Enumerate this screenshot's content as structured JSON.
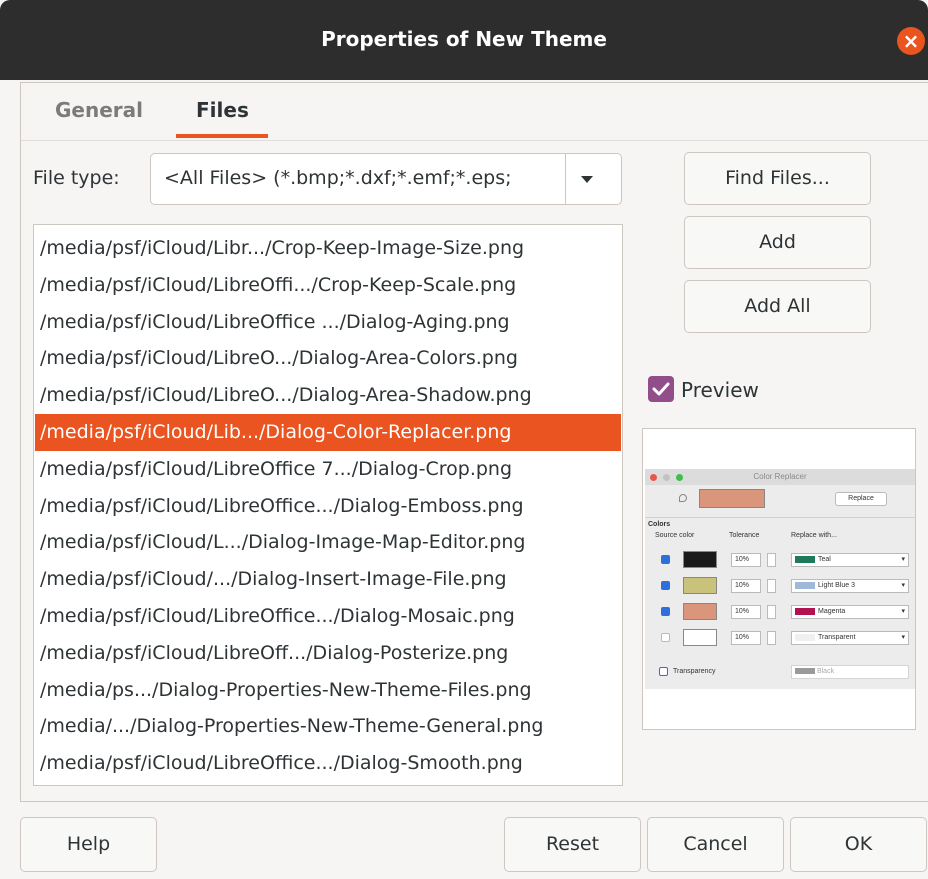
{
  "window": {
    "title": "Properties of New Theme",
    "close_glyph": "×"
  },
  "tabs": [
    {
      "label": "General",
      "active": false
    },
    {
      "label": "Files",
      "active": true
    }
  ],
  "file_type": {
    "label": "File type:",
    "value": "<All Files> (*.bmp;*.dxf;*.emf;*.eps;"
  },
  "files": [
    "/media/psf/iCloud/Libr.../Crop-Keep-Image-Size.png",
    "/media/psf/iCloud/LibreOffi.../Crop-Keep-Scale.png",
    "/media/psf/iCloud/LibreOffice .../Dialog-Aging.png",
    "/media/psf/iCloud/LibreO.../Dialog-Area-Colors.png",
    "/media/psf/iCloud/LibreO.../Dialog-Area-Shadow.png",
    "/media/psf/iCloud/Lib.../Dialog-Color-Replacer.png",
    "/media/psf/iCloud/LibreOffice 7.../Dialog-Crop.png",
    "/media/psf/iCloud/LibreOffice.../Dialog-Emboss.png",
    "/media/psf/iCloud/L.../Dialog-Image-Map-Editor.png",
    "/media/psf/iCloud/.../Dialog-Insert-Image-File.png",
    "/media/psf/iCloud/LibreOffice.../Dialog-Mosaic.png",
    "/media/psf/iCloud/LibreOff.../Dialog-Posterize.png",
    "/media/ps.../Dialog-Properties-New-Theme-Files.png",
    "/media/.../Dialog-Properties-New-Theme-General.png",
    "/media/psf/iCloud/LibreOffice.../Dialog-Smooth.png"
  ],
  "selected_file_index": 5,
  "side_buttons": {
    "find_files": "Find Files...",
    "add": "Add",
    "add_all": "Add All"
  },
  "preview": {
    "label": "Preview",
    "checked": true,
    "thumbnail": {
      "title": "Color Replacer",
      "replace_button": "Replace",
      "colors_heading": "Colors",
      "col_source": "Source color",
      "col_tolerance": "Tolerance",
      "col_replace": "Replace with...",
      "rows": [
        {
          "tolerance": "10%",
          "replace": "Teal",
          "source_color": "#1a1a1a",
          "replace_color": "#1f7a5c",
          "checked": true
        },
        {
          "tolerance": "10%",
          "replace": "Light Blue 3",
          "source_color": "#c8c27a",
          "replace_color": "#9fb9d8",
          "checked": true
        },
        {
          "tolerance": "10%",
          "replace": "Magenta",
          "source_color": "#d9967a",
          "replace_color": "#b0134f",
          "checked": true
        },
        {
          "tolerance": "10%",
          "replace": "Transparent",
          "source_color": "#ffffff",
          "replace_color": "#f0f0f0",
          "checked": false
        }
      ],
      "transparency_label": "Transparency",
      "transparency_value": "Black",
      "picked_color": "#d9967a"
    }
  },
  "footer": {
    "help": "Help",
    "reset": "Reset",
    "cancel": "Cancel",
    "ok": "OK"
  },
  "colors": {
    "accent": "#e95420",
    "checkbox": "#924d8b",
    "titlebar": "#2d2d2d"
  }
}
